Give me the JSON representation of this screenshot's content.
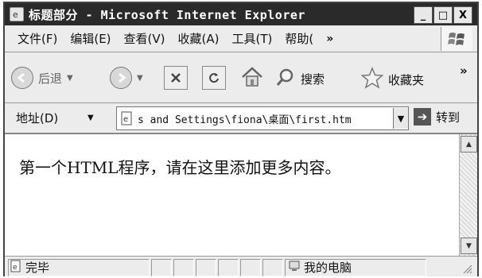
{
  "window": {
    "title": "标题部分 - Microsoft Internet Explorer"
  },
  "titlebar_buttons": {
    "minimize": "_",
    "maximize": "□",
    "close": "X"
  },
  "menu": {
    "items": [
      "文件(F)",
      "编辑(E)",
      "查看(V)",
      "收藏(A)",
      "工具(T)",
      "帮助("
    ],
    "overflow": "»"
  },
  "toolbar": {
    "back_label": "后退",
    "search_label": "搜索",
    "favorites_label": "收藏夹",
    "overflow": "»"
  },
  "address": {
    "label": "地址(D)",
    "value": "s and Settings\\fiona\\桌面\\first.htm",
    "go_label": "转到"
  },
  "content": {
    "text": "第一个HTML程序，请在这里添加更多内容。"
  },
  "status": {
    "left_text": "完毕",
    "zone_text": "我的电脑"
  },
  "colors": {
    "titlebar": "#2a2a2a",
    "chrome": "#ececec",
    "page": "#ffffff"
  }
}
